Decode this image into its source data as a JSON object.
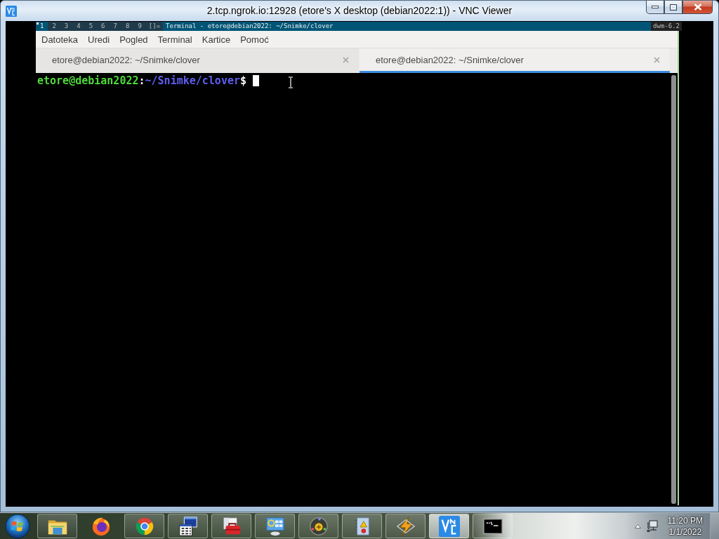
{
  "window": {
    "title": "2.tcp.ngrok.io:12928 (etore's X desktop (debian2022:1)) - VNC Viewer"
  },
  "dwm_bar": {
    "tags": [
      {
        "label": "1",
        "selected": true,
        "occupied": true
      },
      {
        "label": "2",
        "selected": false,
        "occupied": false
      },
      {
        "label": "3",
        "selected": false,
        "occupied": false
      },
      {
        "label": "4",
        "selected": false,
        "occupied": false
      },
      {
        "label": "5",
        "selected": false,
        "occupied": false
      },
      {
        "label": "6",
        "selected": false,
        "occupied": false
      },
      {
        "label": "7",
        "selected": false,
        "occupied": false
      },
      {
        "label": "8",
        "selected": false,
        "occupied": false
      },
      {
        "label": "9",
        "selected": false,
        "occupied": false
      }
    ],
    "layout": "[]=",
    "title": "Terminal - etore@debian2022: ~/Snimke/clover",
    "status": "dwm-6.2"
  },
  "terminal": {
    "menu": [
      "Datoteka",
      "Uredi",
      "Pogled",
      "Terminal",
      "Kartice",
      "Pomoć"
    ],
    "tabs": [
      {
        "label": "etore@debian2022: ~/Snimke/clover",
        "selected": false
      },
      {
        "label": "etore@debian2022: ~/Snimke/clover",
        "selected": true
      }
    ],
    "prompt": {
      "user_host": "etore@debian2022",
      "separator": ":",
      "path": "~/Snimke/clover",
      "symbol": "$"
    }
  },
  "taskbar": {
    "apps": [
      {
        "kind": "folder",
        "running": true,
        "active": false
      },
      {
        "kind": "fox",
        "running": false,
        "active": false
      },
      {
        "kind": "wheel",
        "running": true,
        "active": false
      },
      {
        "kind": "windows",
        "running": true,
        "active": false
      },
      {
        "kind": "toolbox",
        "running": true,
        "active": false
      },
      {
        "kind": "panel",
        "running": true,
        "active": false
      },
      {
        "kind": "disc",
        "running": true,
        "active": false
      },
      {
        "kind": "notebook",
        "running": true,
        "active": false
      },
      {
        "kind": "bolt",
        "running": true,
        "active": false
      },
      {
        "kind": "vnc",
        "running": true,
        "active": true
      },
      {
        "kind": "console",
        "running": true,
        "active": false
      }
    ],
    "clock": {
      "time": "11:20 PM",
      "date": "1/1/2022"
    }
  }
}
